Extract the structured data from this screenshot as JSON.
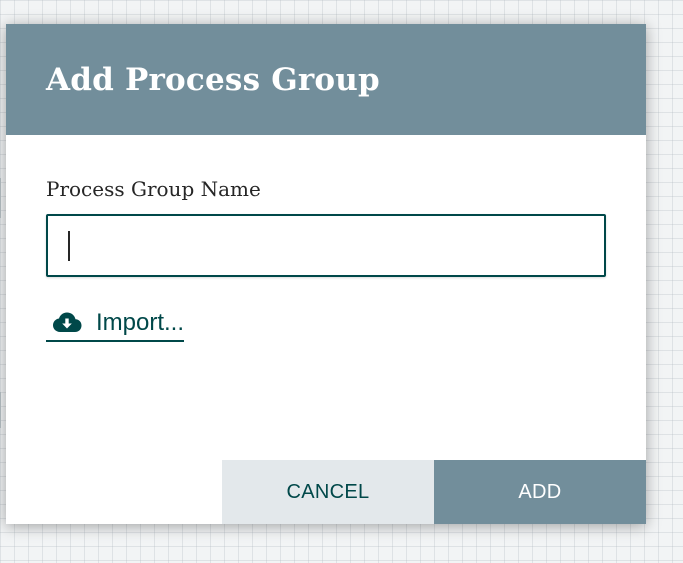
{
  "dialog": {
    "title": "Add Process Group",
    "field_label": "Process Group Name",
    "name_value": "",
    "import_label": "Import...",
    "cancel_label": "CANCEL",
    "add_label": "ADD"
  },
  "icons": {
    "import": "cloud-download-icon"
  },
  "colors": {
    "header": "#728e9b",
    "accent": "#004849",
    "cancel_bg": "#e3e8eb",
    "add_bg": "#728e9b"
  }
}
